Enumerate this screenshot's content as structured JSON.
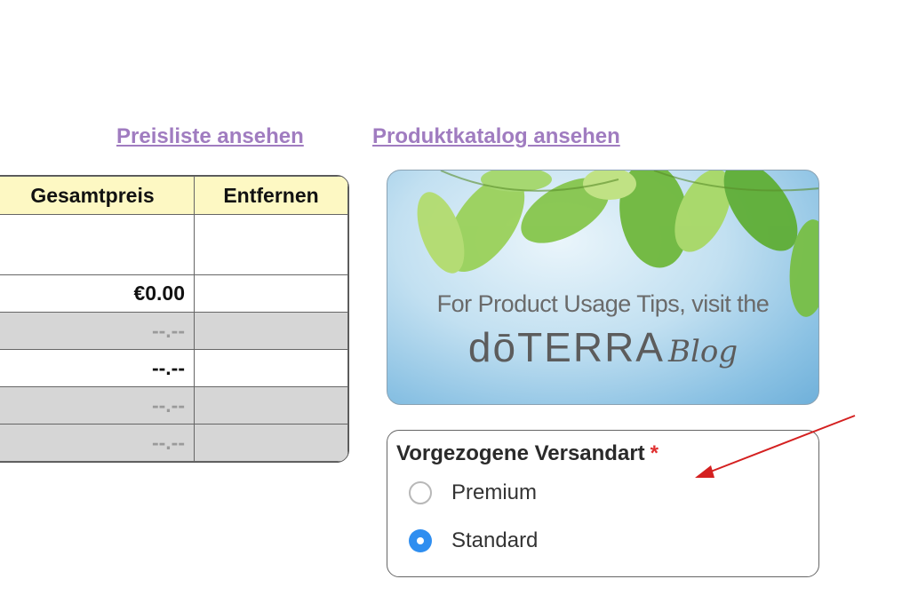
{
  "links": {
    "price_list": "Preisliste ansehen",
    "product_catalog": "Produktkatalog ansehen"
  },
  "cart": {
    "headers": [
      "Gesamtpreis",
      "Entfernen"
    ],
    "rows": [
      {
        "total": "€0.00",
        "remove": ""
      },
      {
        "total": "--.--",
        "remove": ""
      },
      {
        "total": "--.--",
        "remove": ""
      },
      {
        "total": "--.--",
        "remove": ""
      },
      {
        "total": "--.--",
        "remove": ""
      }
    ]
  },
  "banner": {
    "tagline": "For Product Usage Tips, visit the",
    "brand": "dōTERRA",
    "brand_suffix": "Blog"
  },
  "shipping": {
    "title": "Vorgezogene Versandart",
    "required_mark": "*",
    "options": [
      {
        "label": "Premium",
        "selected": false
      },
      {
        "label": "Standard",
        "selected": true
      }
    ]
  },
  "colors": {
    "link": "#a07cc0",
    "header_bg": "#fdf8c3",
    "row_gray": "#d6d6d6",
    "radio_selected": "#2f8ef0",
    "arrow": "#d42020"
  }
}
